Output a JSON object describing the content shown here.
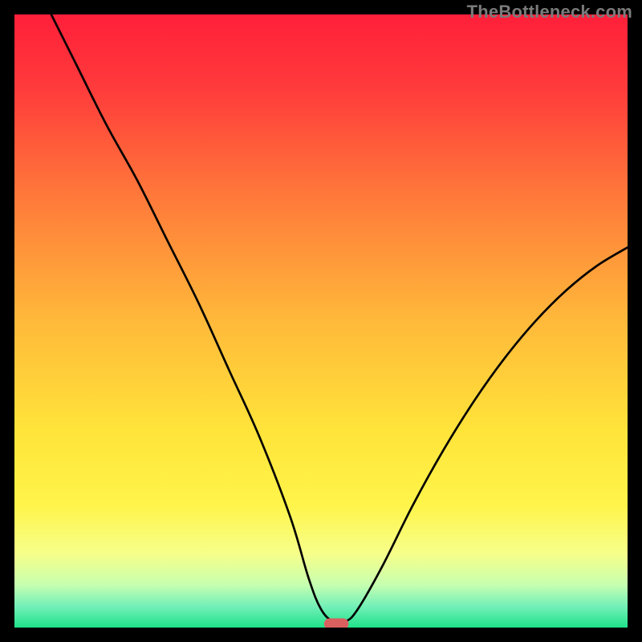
{
  "attribution": "TheBottleneck.com",
  "chart_data": {
    "type": "line",
    "title": "",
    "xlabel": "",
    "ylabel": "",
    "xlim": [
      0,
      100
    ],
    "ylim": [
      0,
      100
    ],
    "series": [
      {
        "name": "curve",
        "x": [
          6,
          10,
          15,
          20,
          25,
          30,
          35,
          40,
          45,
          48,
          50,
          52,
          54,
          56,
          60,
          65,
          70,
          75,
          80,
          85,
          90,
          95,
          100
        ],
        "y": [
          100,
          92,
          82,
          73,
          63,
          53,
          42,
          31,
          18,
          8,
          3,
          1,
          1,
          3,
          10,
          20,
          29,
          37,
          44,
          50,
          55,
          59,
          62
        ]
      }
    ],
    "marker": {
      "x_range": [
        50.5,
        54.5
      ],
      "y": 0.6
    },
    "background": {
      "type": "vertical-gradient",
      "stops": [
        {
          "offset": 0.0,
          "color": "#ff1f3a"
        },
        {
          "offset": 0.12,
          "color": "#ff3b3b"
        },
        {
          "offset": 0.3,
          "color": "#ff7a3a"
        },
        {
          "offset": 0.5,
          "color": "#ffb93a"
        },
        {
          "offset": 0.68,
          "color": "#ffe43a"
        },
        {
          "offset": 0.8,
          "color": "#fff44a"
        },
        {
          "offset": 0.88,
          "color": "#f6ff8a"
        },
        {
          "offset": 0.93,
          "color": "#c7ffb0"
        },
        {
          "offset": 0.965,
          "color": "#74f0b8"
        },
        {
          "offset": 1.0,
          "color": "#1fe28a"
        }
      ]
    }
  }
}
